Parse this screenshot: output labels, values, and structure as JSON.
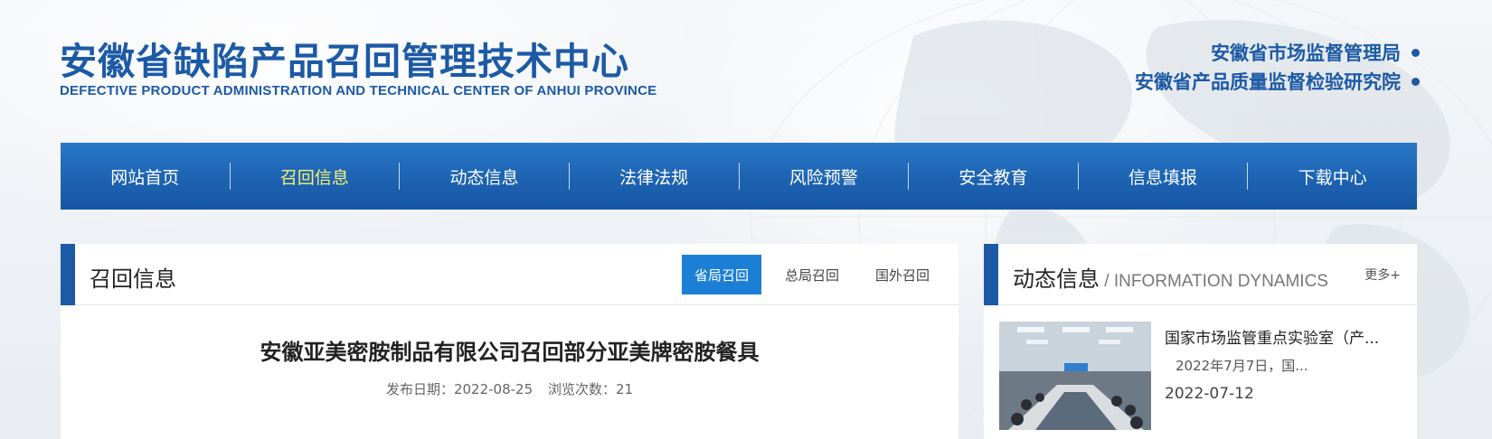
{
  "header": {
    "title_cn": "安徽省缺陷产品召回管理技术中心",
    "title_en": "DEFECTIVE PRODUCT ADMINISTRATION AND TECHNICAL CENTER OF ANHUI PROVINCE",
    "orgs": [
      "安徽省市场监督管理局",
      "安徽省产品质量监督检验研究院"
    ]
  },
  "nav": {
    "items": [
      "网站首页",
      "召回信息",
      "动态信息",
      "法律法规",
      "风险预警",
      "安全教育",
      "信息填报",
      "下载中心"
    ],
    "active_index": 1
  },
  "recall_panel": {
    "title": "召回信息",
    "tabs": [
      "省局召回",
      "总局召回",
      "国外召回"
    ],
    "active_tab": 0,
    "article": {
      "title": "安徽亚美密胺制品有限公司召回部分亚美牌密胺餐具",
      "date_label": "发布日期：2022-08-25",
      "views_label": "浏览次数：21"
    }
  },
  "dynamics_panel": {
    "title_cn": "动态信息",
    "title_en": " / INFORMATION DYNAMICS",
    "more": "更多+",
    "news": {
      "title": "国家市场监管重点实验室（产...",
      "summary": "2022年7月7日，国...",
      "date": "2022-07-12"
    }
  },
  "colors": {
    "brand_blue": "#1c5aa6",
    "nav_active_text": "#f7f070",
    "tab_active_bg": "#1c7fd6"
  }
}
